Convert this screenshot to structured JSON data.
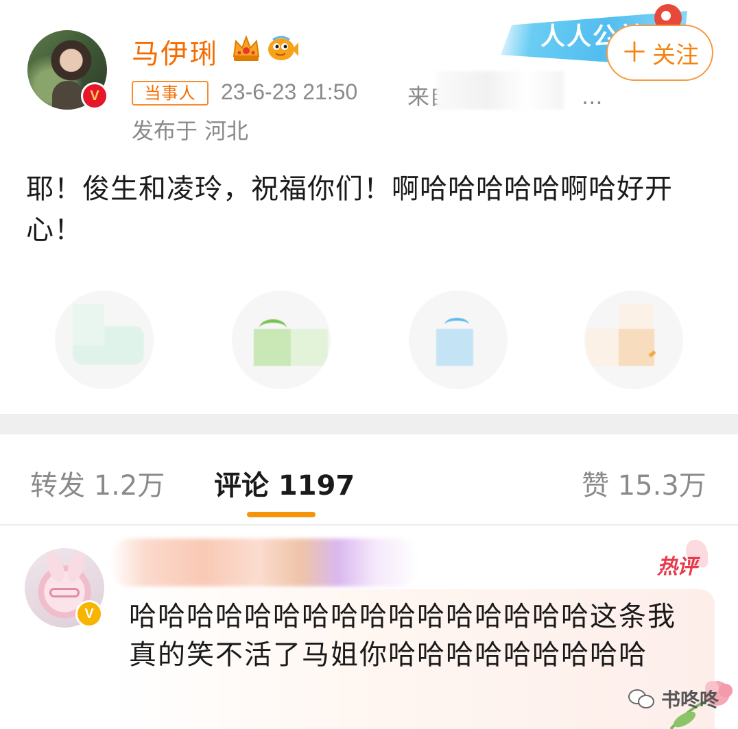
{
  "post": {
    "username": "马伊琍",
    "party_badge": "当事人",
    "time": "23-6-23 21:50",
    "source_label": "来自",
    "source_ellipsis": "...",
    "location": "发布于 河北",
    "text": "耶！俊生和凌玲，祝福你们！啊哈哈哈哈哈啊哈好开心！",
    "follow_label": "关注",
    "follow_plus": "＋",
    "verified_glyph": "V"
  },
  "banner": {
    "text": "人人公益"
  },
  "share": {
    "icons": [
      "wechat-icon",
      "moments-icon",
      "qq-icon",
      "weibo-icon"
    ]
  },
  "tabs": {
    "repost": "转发 1.2万",
    "comment": "评论 1197",
    "like": "赞 15.3万"
  },
  "comment": {
    "hot_label": "热评",
    "text": "哈哈哈哈哈哈哈哈哈哈哈哈哈哈哈哈这条我真的笑不活了马姐你哈哈哈哈哈哈哈哈哈",
    "verified_glyph": "V"
  },
  "watermark": {
    "text": "书咚咚"
  },
  "colors": {
    "accent_orange": "#f56c00",
    "tab_indicator": "#f5930a",
    "verified_red": "#e6162d",
    "verified_gold": "#f7b500",
    "hot_red": "#e83a4d"
  }
}
